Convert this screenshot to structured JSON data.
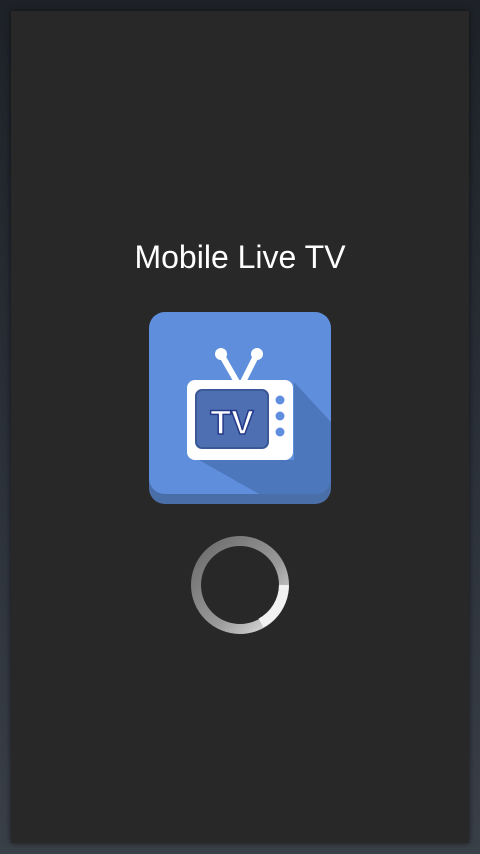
{
  "app": {
    "title": "Mobile Live TV",
    "icon_name": "tv-icon",
    "icon_text": "TV"
  },
  "loading": {
    "indicator": "spinner-icon"
  },
  "colors": {
    "background": "#282828",
    "icon_blue": "#5b8dd9",
    "icon_shadow": "#4a73b4",
    "title_text": "#ffffff"
  }
}
